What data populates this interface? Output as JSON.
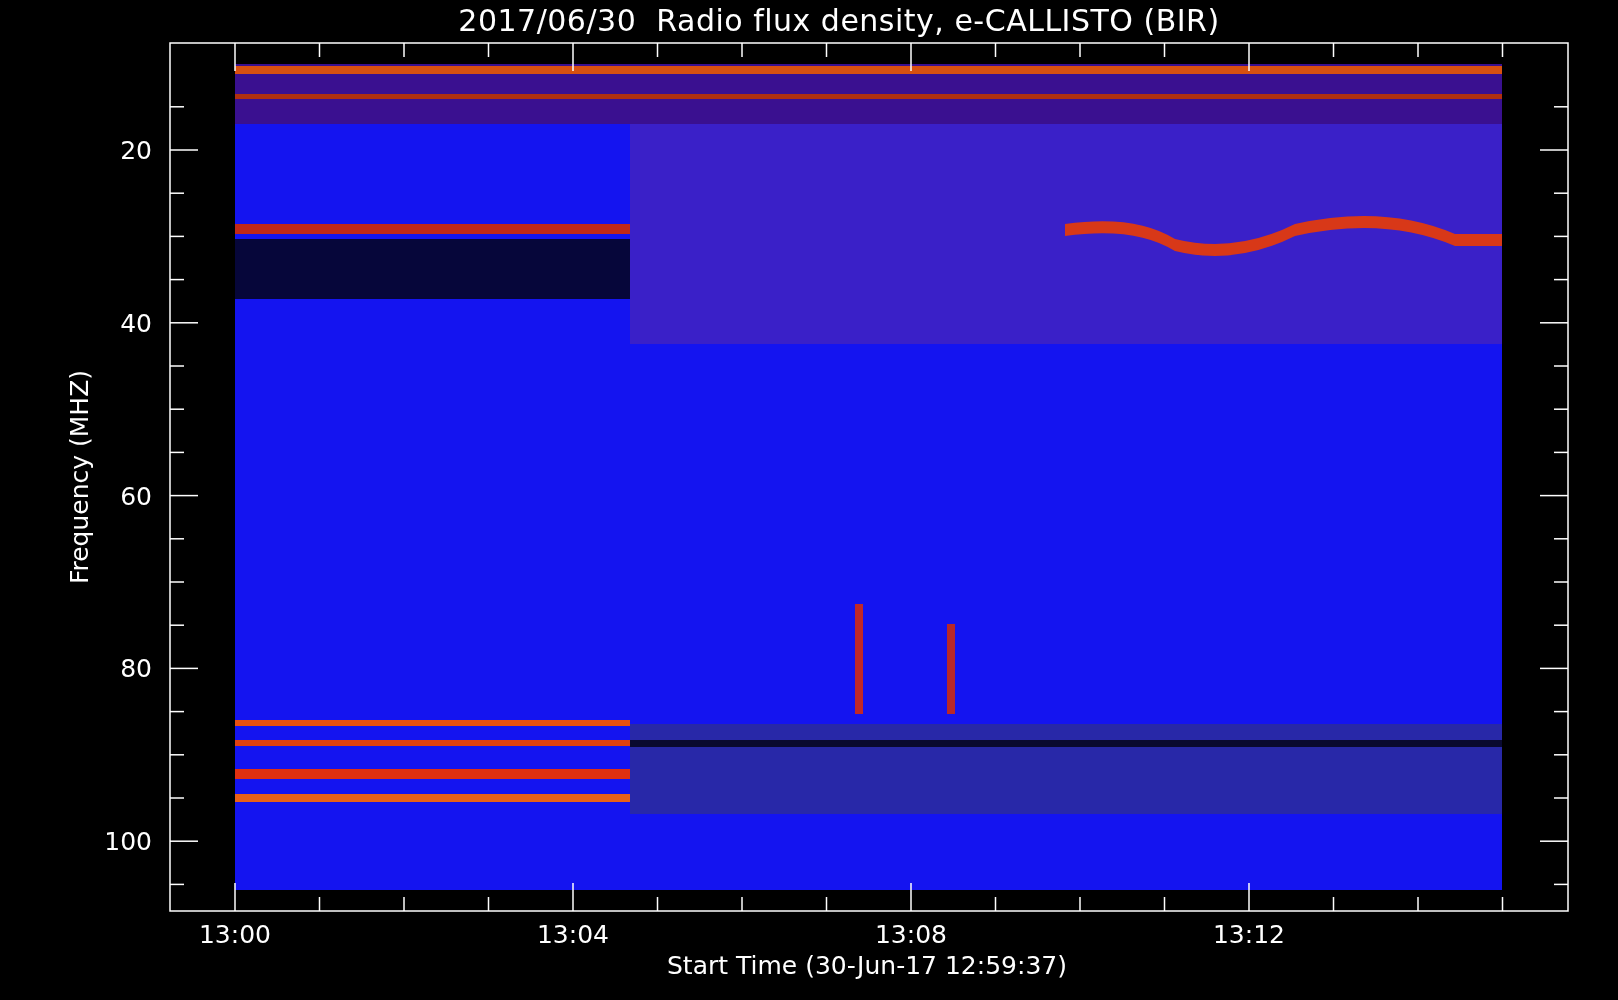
{
  "title": "2017/06/30  Radio flux density, e-CALLISTO (BIR)",
  "y_axis": {
    "label": "Frequency (MHZ)",
    "ticks": [
      "20",
      "40",
      "60",
      "80",
      "100"
    ]
  },
  "x_axis": {
    "label": "Start Time (30-Jun-17 12:59:37)",
    "ticks": [
      "13:00",
      "13:04",
      "13:08",
      "13:12"
    ]
  }
}
